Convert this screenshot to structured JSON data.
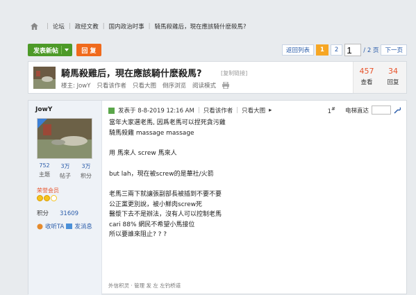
{
  "breadcrumb": [
    "论坛",
    "政经文教",
    "国内政治时事",
    "騎馬殺雞后，現在應該騎什麽殺馬?"
  ],
  "toolbar": {
    "new_label": "发表新帖",
    "reply_label": "回 复"
  },
  "pager": {
    "back": "返回列表",
    "pages": [
      "1",
      "2"
    ],
    "current_value": "1",
    "total": "/ 2 页",
    "next": "下一页"
  },
  "thread": {
    "title": "騎馬殺雞后，現在應該騎什麽殺馬?",
    "copy_link": "[复制链接]",
    "owner": "楼主: JowY",
    "only_author": "只看该作者",
    "big_image": "只看大图",
    "reverse": "倒序浏览",
    "read_mode": "阅读模式",
    "views": "457",
    "views_label": "查看",
    "replies": "34",
    "replies_label": "回复"
  },
  "post": {
    "username": "JowY",
    "user_stats": [
      {
        "n": "752",
        "l": "主题"
      },
      {
        "n": "3万",
        "l": "帖子"
      },
      {
        "n": "3万",
        "l": "积分"
      }
    ],
    "honor": "荣誉会员",
    "points_label": "积分",
    "points_value": "31609",
    "listen": "收听TA",
    "message": "发消息",
    "posted": "发表于 8-8-2019 12:16 AM",
    "only_author": "只看该作者",
    "big_image": "只看大图",
    "floor": "1",
    "floor_hash": "#",
    "direct": "电梯直达",
    "lines": [
      "當年大家選老馬, 因爲老馬可以捏死貪污雞",
      "騎馬殺雞 massage massage",
      "",
      "用 馬來人 screw 馬來人",
      "",
      "but lah，現在被screw的是華社/火箭",
      "",
      "老馬三兩下就讓張副部長被插到不要不要",
      "公正黨更別說，被小鮮肉screw死",
      "醫漿下去不是辦法，沒有人可以控制老馬",
      "cari 88% 網民不希望小馬接位",
      "所以要誰來阻止? ? ?"
    ],
    "footer": "外信积灵 · 管理 发 左 左钓桥道"
  }
}
